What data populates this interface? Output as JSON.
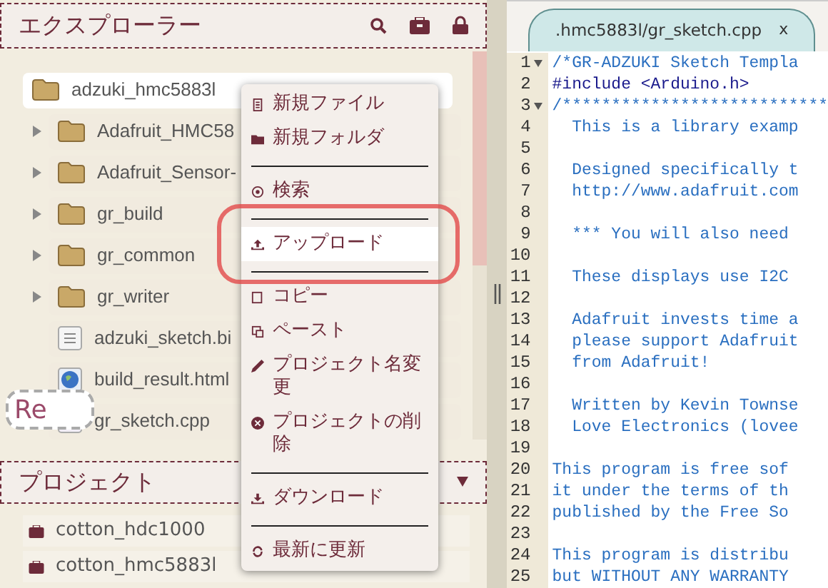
{
  "explorer": {
    "title": "エクスプローラー",
    "tree": {
      "label": "adzuki_hmc5883l",
      "kind": "folder",
      "expanded": true,
      "selected": true,
      "children": [
        {
          "label": "Adafruit_HMC58",
          "kind": "folder",
          "expanded": false,
          "selected": false
        },
        {
          "label": "Adafruit_Sensor-",
          "kind": "folder",
          "expanded": false,
          "selected": false
        },
        {
          "label": "gr_build",
          "kind": "folder",
          "expanded": false,
          "selected": false
        },
        {
          "label": "gr_common",
          "kind": "folder",
          "expanded": false,
          "selected": false
        },
        {
          "label": "gr_writer",
          "kind": "folder",
          "expanded": false,
          "selected": false
        },
        {
          "label": "adzuki_sketch.bi",
          "kind": "text-file",
          "selected": false
        },
        {
          "label": "build_result.html",
          "kind": "web-file",
          "selected": false
        },
        {
          "label": "gr_sketch.cpp",
          "kind": "code-file",
          "selected": false
        }
      ]
    },
    "tooltip": "Re"
  },
  "project": {
    "title": "プロジェクト",
    "items": [
      "cotton_hdc1000",
      "cotton_hmc5883l"
    ]
  },
  "context_menu": [
    {
      "kind": "item",
      "label": "新規ファイル",
      "selected": false
    },
    {
      "kind": "item",
      "label": "新規フォルダ",
      "selected": false
    },
    {
      "kind": "separator"
    },
    {
      "kind": "item",
      "label": "検索",
      "selected": false
    },
    {
      "kind": "separator"
    },
    {
      "kind": "item",
      "label": "アップロード",
      "selected": true
    },
    {
      "kind": "separator"
    },
    {
      "kind": "item",
      "label": "コピー",
      "selected": false
    },
    {
      "kind": "item",
      "label": "ペースト",
      "selected": false
    },
    {
      "kind": "item",
      "label": "プロジェクト名変更",
      "selected": false
    },
    {
      "kind": "item",
      "label": "プロジェクトの削除",
      "selected": false
    },
    {
      "kind": "separator"
    },
    {
      "kind": "item",
      "label": "ダウンロード",
      "selected": false
    },
    {
      "kind": "separator"
    },
    {
      "kind": "item",
      "label": "最新に更新",
      "selected": false
    }
  ],
  "editor": {
    "tab": {
      "label": ".hmc5883l/gr_sketch.cpp",
      "close": "x"
    },
    "lines": [
      {
        "number": "1",
        "text": "/*GR-ADZUKI Sketch Templa",
        "fold": true,
        "kind": "comment"
      },
      {
        "number": "2",
        "text": "#include <Arduino.h>",
        "fold": false,
        "kind": "code"
      },
      {
        "number": "3",
        "text": "/***************************",
        "fold": true,
        "kind": "comment"
      },
      {
        "number": "4",
        "text": "  This is a library examp",
        "fold": false,
        "kind": "comment"
      },
      {
        "number": "5",
        "fold": false
      },
      {
        "number": "6",
        "text": "  Designed specifically t",
        "fold": false,
        "kind": "comment"
      },
      {
        "number": "7",
        "text": "  http://www.adafruit.com",
        "fold": false,
        "kind": "comment"
      },
      {
        "number": "8",
        "fold": false
      },
      {
        "number": "9",
        "text": "  *** You will also need",
        "fold": false,
        "kind": "comment"
      },
      {
        "number": "10",
        "fold": false
      },
      {
        "number": "11",
        "text": "  These displays use I2C",
        "fold": false,
        "kind": "comment"
      },
      {
        "number": "12",
        "fold": false
      },
      {
        "number": "13",
        "text": "  Adafruit invests time a",
        "fold": false,
        "kind": "comment"
      },
      {
        "number": "14",
        "text": "  please support Adafruit",
        "fold": false,
        "kind": "comment"
      },
      {
        "number": "15",
        "text": "  from Adafruit!",
        "fold": false,
        "kind": "comment"
      },
      {
        "number": "16",
        "fold": false
      },
      {
        "number": "17",
        "text": "  Written by Kevin Townse",
        "fold": false,
        "kind": "comment"
      },
      {
        "number": "18",
        "text": "  Love Electronics (lovee",
        "fold": false,
        "kind": "comment"
      },
      {
        "number": "19",
        "fold": false
      },
      {
        "number": "20",
        "text": "This program is free sof",
        "fold": false,
        "kind": "comment"
      },
      {
        "number": "21",
        "text": "it under the terms of th",
        "fold": false,
        "kind": "comment"
      },
      {
        "number": "22",
        "text": "published by the Free So",
        "fold": false,
        "kind": "comment"
      },
      {
        "number": "23",
        "fold": false
      },
      {
        "number": "24",
        "text": "This program is distribu",
        "fold": false,
        "kind": "comment"
      },
      {
        "number": "25",
        "text": "but WITHOUT ANY WARRANTY",
        "fold": false,
        "kind": "comment"
      }
    ]
  }
}
